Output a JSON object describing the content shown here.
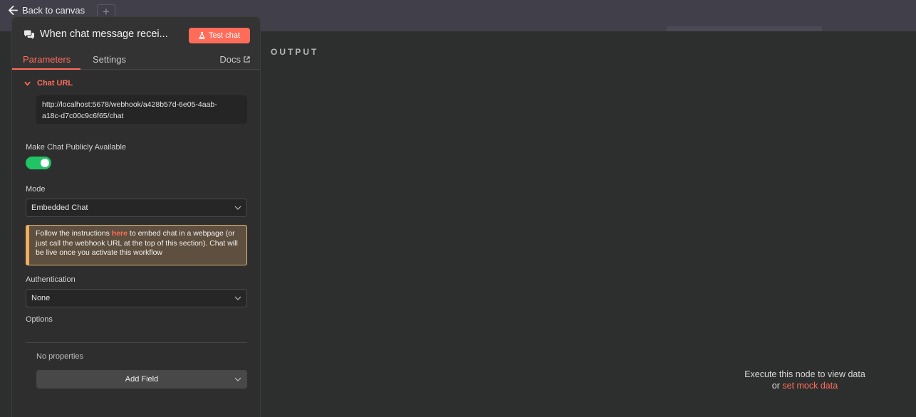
{
  "canvas": {
    "back_label": "Back to canvas",
    "plus_label": "+"
  },
  "node": {
    "title": "When chat message recei...",
    "test_button": "Test chat",
    "icon": "chat-bubbles-icon"
  },
  "tabs": {
    "parameters": "Parameters",
    "settings": "Settings",
    "docs": "Docs"
  },
  "chat_url": {
    "section_label": "Chat URL",
    "line1": "http://localhost:5678/webhook/a428b57d-6e05-4aab-",
    "line2": "a18c-d7c00c9c6f65/chat"
  },
  "public": {
    "label": "Make Chat Publicly Available",
    "enabled": true
  },
  "mode": {
    "label": "Mode",
    "value": "Embedded Chat"
  },
  "notice": {
    "before": "Follow the instructions ",
    "link": "here",
    "after": " to embed chat in a webpage (or just call the webhook URL at the top of this section). Chat will be live once you activate this workflow"
  },
  "authentication": {
    "label": "Authentication",
    "value": "None"
  },
  "options": {
    "label": "Options",
    "empty": "No properties",
    "add_button": "Add Field"
  },
  "output": {
    "title": "OUTPUT",
    "empty_line1": "Execute this node to view data",
    "empty_or": "or ",
    "mock_link": "set mock data"
  },
  "colors": {
    "accent": "#ff6d5a",
    "toggle_on": "#20c464",
    "notice_border": "#f0ae5c"
  }
}
